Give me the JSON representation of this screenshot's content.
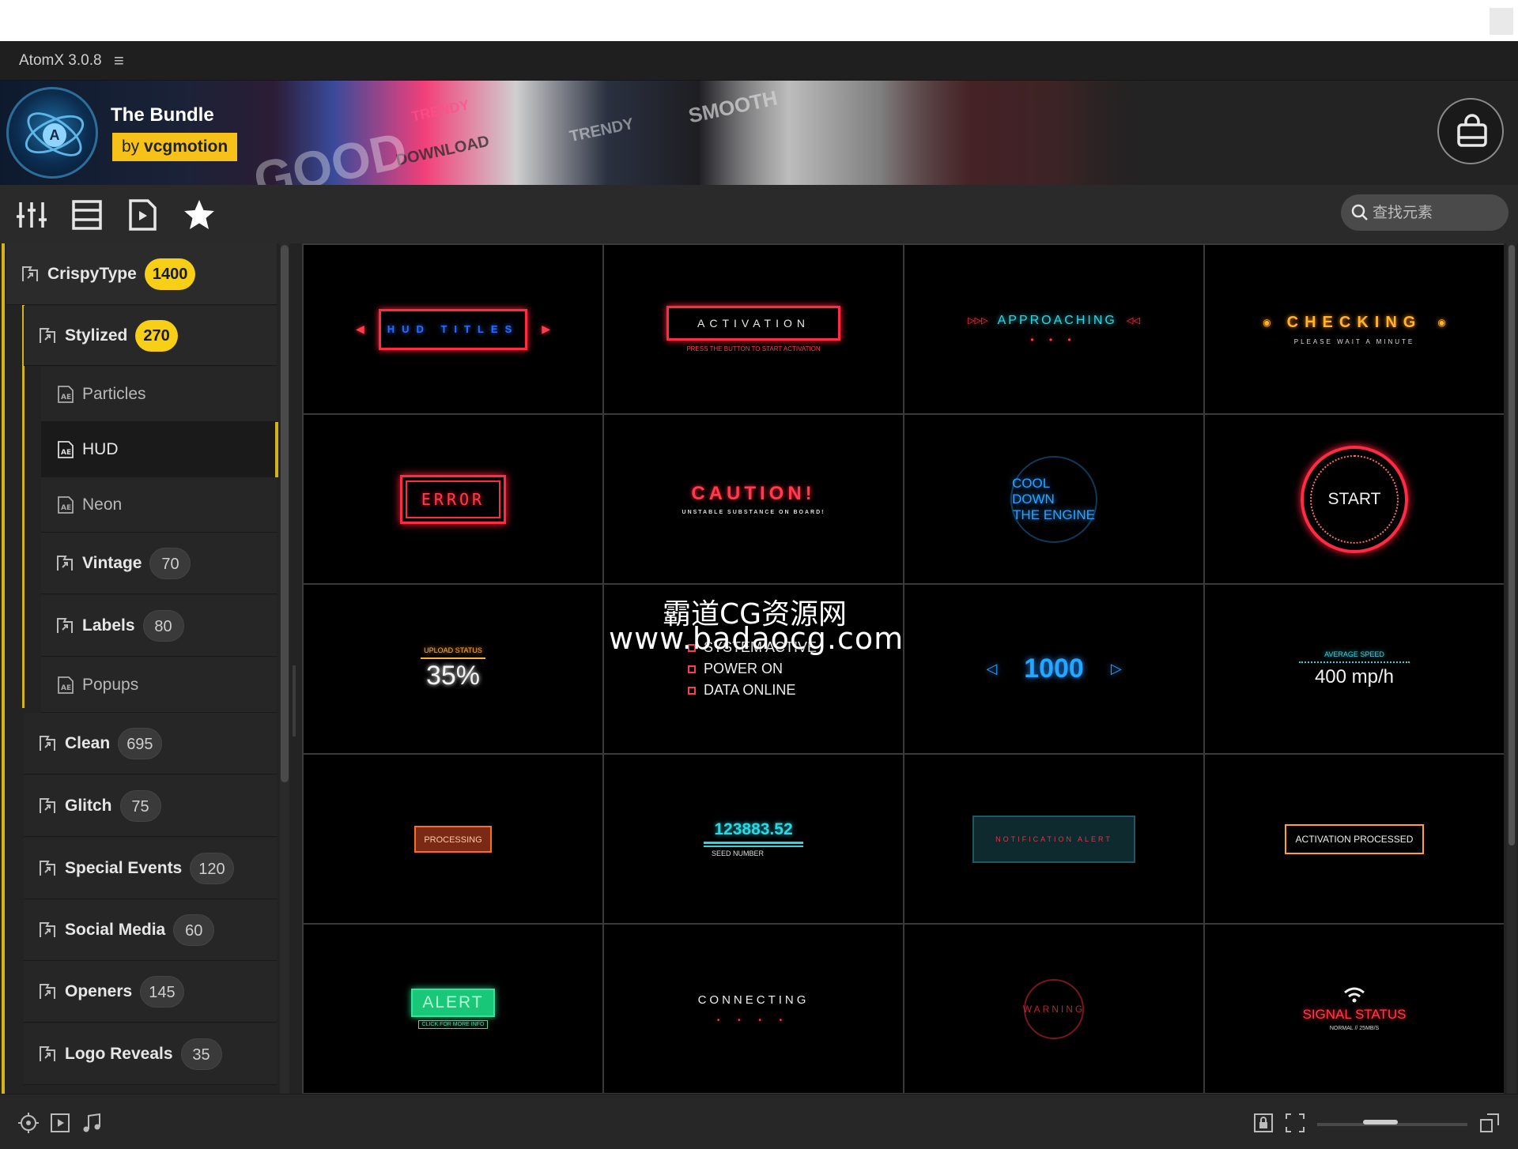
{
  "window": {
    "title": "AtomX 3.0.8",
    "menu_glyph": "≡"
  },
  "banner": {
    "title": "The Bundle",
    "by_prefix": "by",
    "by_name": "vcgmotion",
    "logo_letter": "A",
    "deco_texts": [
      "TRENDY",
      "DOWNLOAD",
      "SMOOTH",
      "GOOD"
    ]
  },
  "toolbar": {
    "tools": [
      "sliders-icon",
      "list-icon",
      "play-file-icon",
      "star-icon"
    ],
    "search_placeholder": "查找元素"
  },
  "sidebar": {
    "items": [
      {
        "label": "CrispyType",
        "count": "1400",
        "type": "folder",
        "level": 0,
        "badge": "yellow"
      },
      {
        "label": "Stylized",
        "count": "270",
        "type": "folder",
        "level": 1,
        "badge": "yellow"
      },
      {
        "label": "Particles",
        "type": "file",
        "level": 2
      },
      {
        "label": "HUD",
        "type": "file",
        "level": 2,
        "selected": true
      },
      {
        "label": "Neon",
        "type": "file",
        "level": 2
      },
      {
        "label": "Vintage",
        "count": "70",
        "type": "folder",
        "level": 2,
        "badge": "gray"
      },
      {
        "label": "Labels",
        "count": "80",
        "type": "folder",
        "level": 2,
        "badge": "gray"
      },
      {
        "label": "Popups",
        "type": "file",
        "level": 2
      },
      {
        "label": "Clean",
        "count": "695",
        "type": "folder",
        "level": 1,
        "badge": "gray"
      },
      {
        "label": "Glitch",
        "count": "75",
        "type": "folder",
        "level": 1,
        "badge": "gray"
      },
      {
        "label": "Special Events",
        "count": "120",
        "type": "folder",
        "level": 1,
        "badge": "gray"
      },
      {
        "label": "Social Media",
        "count": "60",
        "type": "folder",
        "level": 1,
        "badge": "gray"
      },
      {
        "label": "Openers",
        "count": "145",
        "type": "folder",
        "level": 1,
        "badge": "gray"
      },
      {
        "label": "Logo Reveals",
        "count": "35",
        "type": "folder",
        "level": 1,
        "badge": "gray"
      }
    ]
  },
  "thumbnails": {
    "hud_titles": "HUD TITLES",
    "activation": "ACTIVATION",
    "activation_sub": "PRESS THE BUTTON TO START ACTIVATION",
    "approaching": "APPROACHING",
    "checking": "CHECKING",
    "checking_sub": "PLEASE WAIT A MINUTE",
    "error": "ERROR",
    "caution": "CAUTION!",
    "caution_sub": "UNSTABLE SUBSTANCE ON BOARD!",
    "cooldown_1": "COOL DOWN",
    "cooldown_2": "THE ENGINE",
    "start": "START",
    "upload_label": "UPLOAD STATUS",
    "upload_value": "35%",
    "system_items": [
      "SYSTEM ACTIVE",
      "POWER ON",
      "DATA ONLINE"
    ],
    "counter": "1000",
    "speed_label": "AVERAGE SPEED",
    "speed_value": "400 mp/h",
    "processing": "PROCESSING",
    "seed_value": "123883.52",
    "seed_label": "SEED NUMBER",
    "notification": "NOTIFICATION ALERT",
    "activation_processed": "ACTIVATION PROCESSED",
    "alert": "ALERT",
    "alert_sub": "CLICK FOR MORE INFO",
    "connecting": "CONNECTING",
    "warning": "WARNING",
    "signal": "SIGNAL STATUS",
    "signal_sub": "NORMAL // 25MB/S"
  },
  "watermark": {
    "line1": "霸道CG资源网",
    "line2": "www.badaocg.com"
  },
  "statusbar": {
    "zoom_level": 0.4
  }
}
